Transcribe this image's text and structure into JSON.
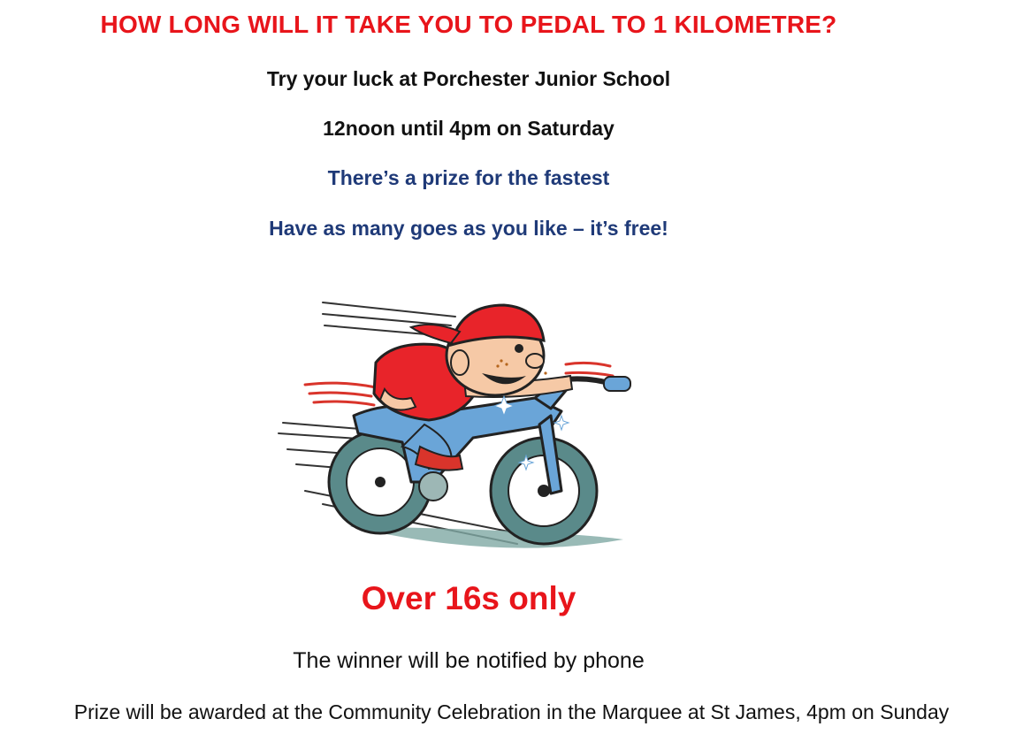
{
  "poster": {
    "headline": "HOW LONG WILL IT TAKE YOU TO PEDAL TO 1 KILOMETRE?",
    "venue_line": "Try your luck at Porchester Junior School",
    "time_line": "12noon until 4pm on Saturday",
    "prize_line": "There’s a prize for the fastest",
    "goes_line": "Have as many goes as you like – it’s free!",
    "age_line": "Over 16s only",
    "notify_line": "The winner will be notified by phone",
    "award_line": "Prize will be awarded at the Community Celebration in the Marquee at St James, 4pm on Sunday"
  },
  "colors": {
    "headline": "#e8151b",
    "highlight": "#1f3a78",
    "body_text": "#111111",
    "cap": "#e8242a",
    "bike_frame": "#6aa5d8",
    "tyre": "#5a8a8a",
    "skin": "#f6c9a6"
  },
  "illustration": {
    "icon": "cartoon-boy-on-bike-icon"
  }
}
